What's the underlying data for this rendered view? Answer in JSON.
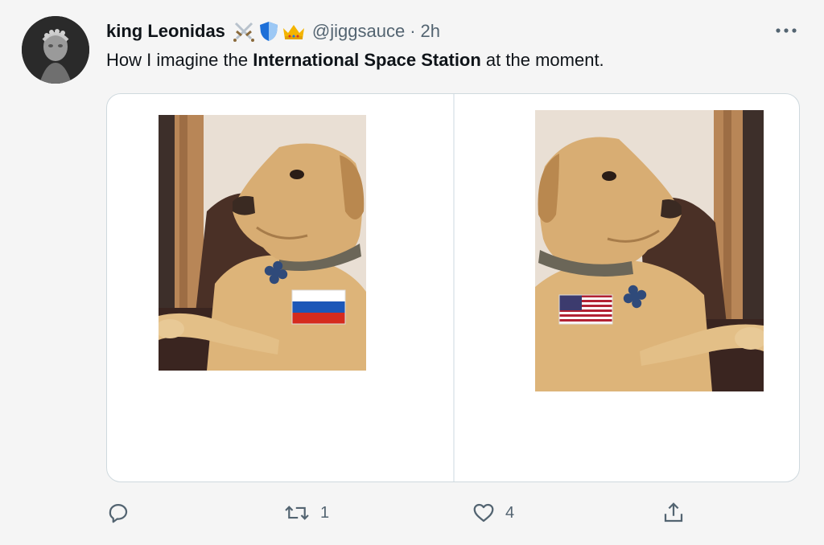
{
  "tweet": {
    "name": "king Leonidas",
    "handle": "@jiggsauce",
    "separator": "·",
    "time": "2h",
    "badges": [
      "crossed-swords-icon",
      "shield-icon",
      "crown-icon"
    ],
    "text_before": "How I imagine the ",
    "text_bold": "International Space Station",
    "text_after": " at the moment.",
    "images": [
      {
        "name": "dog-russia-flag-image",
        "flag": "Russia",
        "facing": "left"
      },
      {
        "name": "dog-usa-flag-image",
        "flag": "USA",
        "facing": "right"
      }
    ]
  },
  "actions": {
    "reply_count": "",
    "retweet_count": "1",
    "like_count": "4"
  },
  "colors": {
    "background": "#f5f5f5",
    "text": "#0f1419",
    "muted": "#536471",
    "border": "#cfd9de"
  }
}
